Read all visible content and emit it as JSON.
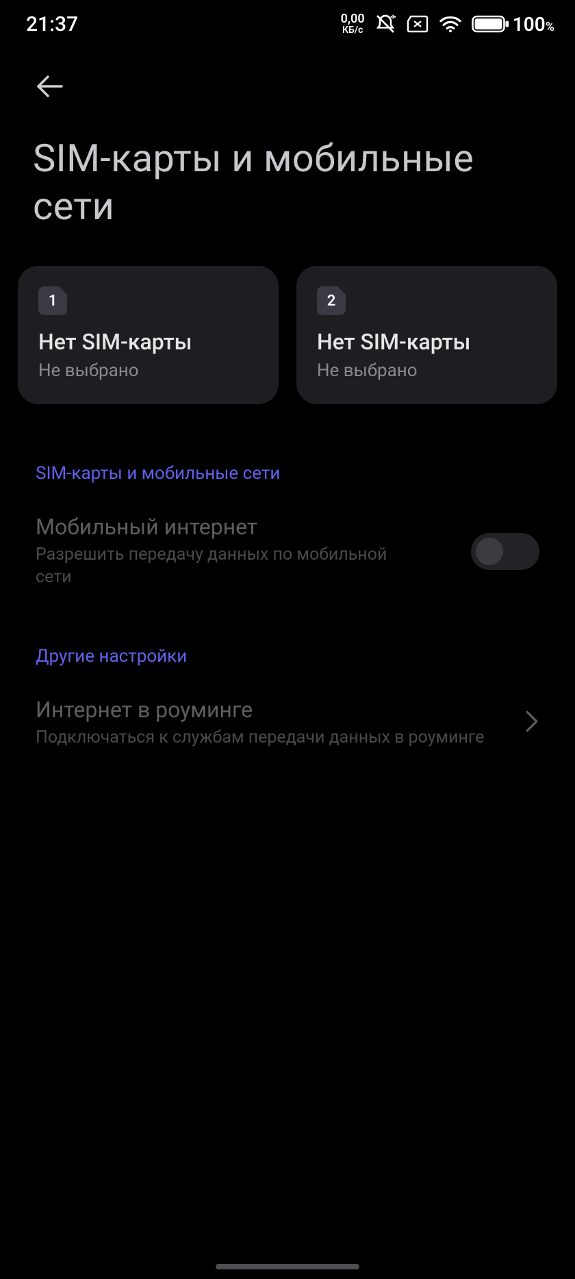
{
  "status": {
    "time": "21:37",
    "net_speed_value": "0,00",
    "net_speed_unit": "КБ/с",
    "battery_pct": "100",
    "battery_pct_suffix": "%"
  },
  "header": {
    "title": "SIM-карты и мобильные сети"
  },
  "sims": [
    {
      "slot": "1",
      "title": "Нет SIM-карты",
      "subtitle": "Не выбрано"
    },
    {
      "slot": "2",
      "title": "Нет SIM-карты",
      "subtitle": "Не выбрано"
    }
  ],
  "section1": {
    "header": "SIM-карты и мобильные сети",
    "mobile_data": {
      "title": "Мобильный интернет",
      "subtitle": "Разрешить передачу данных по мобильной сети",
      "enabled": false
    }
  },
  "section2": {
    "header": "Другие настройки",
    "roaming": {
      "title": "Интернет в роуминге",
      "subtitle": "Подключаться к службам передачи данных в роуминге"
    }
  }
}
